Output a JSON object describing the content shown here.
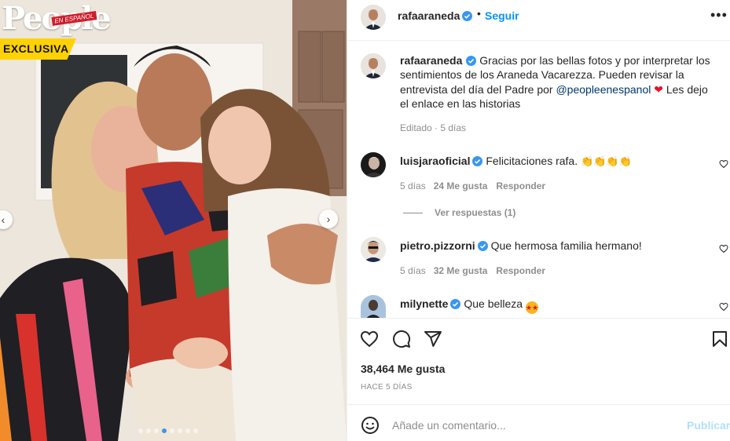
{
  "photo": {
    "brand_logo_text": "People",
    "brand_logo_subtext": "EN ESPAÑOL",
    "exclusive_label": "EXCLUSIVA",
    "prev_icon": "chevron-left-icon",
    "next_icon": "chevron-right-icon",
    "slide_count": 8,
    "active_slide": 4
  },
  "post": {
    "author": "rafaaraneda",
    "follow_label": "Seguir",
    "more_icon": "more-horizontal-icon",
    "caption": {
      "author": "rafaaraneda",
      "text_before_mention": "Gracias por las bellas fotos y por interpretar los sentimientos de los Araneda Vacarezza. Pueden revisar la entrevista del día del Padre por",
      "mention": "@peopleenespanol",
      "text_after_mention": "Les dejo el enlace en las historias",
      "meta": "Editado · 5 días"
    },
    "comments": [
      {
        "user": "luisjaraoficial",
        "text": "Felicitaciones rafa.",
        "time": "5 días",
        "likes": "24 Me gusta",
        "reply": "Responder",
        "replies_label": "Ver respuestas (1)"
      },
      {
        "user": "pietro.pizzorni",
        "text": "Que hermosa familia hermano!",
        "time": "5 días",
        "likes": "32 Me gusta",
        "reply": "Responder"
      },
      {
        "user": "milynette",
        "text": "Que belleza"
      }
    ],
    "actions": {
      "like_icon": "heart-icon",
      "comment_icon": "comment-icon",
      "share_icon": "send-icon",
      "save_icon": "bookmark-icon"
    },
    "likes_count": "38,464 Me gusta",
    "posted_ago": "HACE 5 DÍAS",
    "comment_box": {
      "emoji_icon": "emoji-icon",
      "placeholder": "Añade un comentario...",
      "publish_label": "Publicar"
    }
  },
  "colors": {
    "link": "#0095f6",
    "mention": "#00376b",
    "muted": "#8e8e8e",
    "verified": "#3897f0",
    "publish_disabled": "#b2dffc",
    "exclusive_banner": "#ffd200"
  }
}
